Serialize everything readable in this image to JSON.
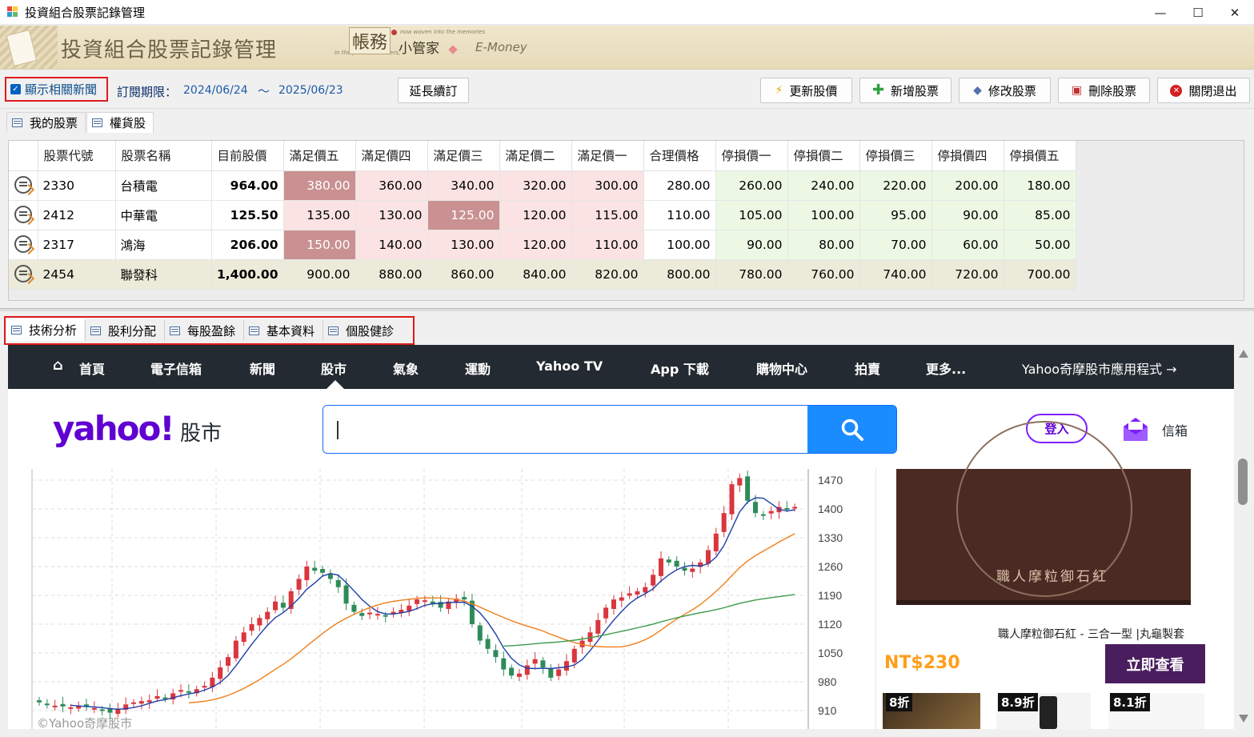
{
  "window": {
    "title": "投資組合股票記錄管理",
    "controls": {
      "minimize": "—",
      "maximize": "☐",
      "close": "✕"
    }
  },
  "banner": {
    "title": "投資組合股票記錄管理",
    "brand_main": "帳務",
    "brand_sub": "小管家",
    "brand_en": "E-Money",
    "tagline1": "now woven into the memories",
    "tagline2": "In the past of numbers,"
  },
  "toolbar": {
    "show_news_label": "顯示相關新聞",
    "show_news_checked": true,
    "subscription_label": "訂閱期限：",
    "subscription_start": "2024/06/24",
    "subscription_sep": "～",
    "subscription_end": "2025/06/23",
    "extend_label": "延長續訂",
    "buttons": {
      "refresh": "更新股價",
      "add": "新增股票",
      "edit": "修改股票",
      "delete": "刪除股票",
      "exit": "關閉退出"
    }
  },
  "top_tabs": [
    {
      "label": "我的股票"
    },
    {
      "label": "權貨股"
    }
  ],
  "grid": {
    "columns": [
      "股票代號",
      "股票名稱",
      "目前股價",
      "滿足價五",
      "滿足價四",
      "滿足價三",
      "滿足價二",
      "滿足價一",
      "合理價格",
      "停損價一",
      "停損價二",
      "停損價三",
      "停損價四",
      "停損價五"
    ],
    "rows": [
      {
        "code": "2330",
        "name": "台積電",
        "price": "964.00",
        "v": [
          "380.00",
          "360.00",
          "340.00",
          "320.00",
          "300.00",
          "280.00",
          "260.00",
          "240.00",
          "220.00",
          "200.00",
          "180.00"
        ]
      },
      {
        "code": "2412",
        "name": "中華電",
        "price": "125.50",
        "v": [
          "135.00",
          "130.00",
          "125.00",
          "120.00",
          "115.00",
          "110.00",
          "105.00",
          "100.00",
          "95.00",
          "90.00",
          "85.00"
        ]
      },
      {
        "code": "2317",
        "name": "鴻海",
        "price": "206.00",
        "v": [
          "150.00",
          "140.00",
          "130.00",
          "120.00",
          "110.00",
          "100.00",
          "90.00",
          "80.00",
          "70.00",
          "60.00",
          "50.00"
        ]
      },
      {
        "code": "2454",
        "name": "聯發科",
        "price": "1,400.00",
        "v": [
          "900.00",
          "880.00",
          "860.00",
          "840.00",
          "820.00",
          "800.00",
          "780.00",
          "760.00",
          "740.00",
          "720.00",
          "700.00"
        ]
      }
    ],
    "highlight_color": "#c99191",
    "target_color": "#fbe3e3",
    "stop_color": "#ecf8e4",
    "selected_row_color": "#ecebd9"
  },
  "bottom_tabs": [
    {
      "label": "技術分析"
    },
    {
      "label": "股利分配"
    },
    {
      "label": "每股盈餘"
    },
    {
      "label": "基本資料"
    },
    {
      "label": "個股健診"
    }
  ],
  "yahoo": {
    "nav": [
      "首頁",
      "電子信箱",
      "新聞",
      "股市",
      "氣象",
      "運動",
      "Yahoo TV",
      "App 下載",
      "購物中心",
      "拍賣",
      "更多...",
      "Yahoo奇摩股市應用程式 →"
    ],
    "logo": "yahoo!",
    "logo_sub": "股市",
    "search_value": "",
    "login_label": "登入",
    "mail_label": "信箱",
    "brand_color": "#6001d2",
    "nav_bg": "#232a31",
    "search_button_color": "#1a8cff"
  },
  "chart_data": {
    "type": "line",
    "title": "",
    "watermark": "©Yahoo奇摩股市",
    "y_ticks": [
      "1470",
      "1400",
      "1330",
      "1260",
      "1190",
      "1120",
      "1050",
      "980",
      "910"
    ],
    "ylim": [
      880,
      1500
    ],
    "candles_close": [
      930,
      925,
      922,
      920,
      918,
      921,
      919,
      916,
      912,
      905,
      915,
      925,
      930,
      933,
      935,
      945,
      940,
      952,
      960,
      955,
      962,
      970,
      990,
      1015,
      1040,
      1080,
      1100,
      1120,
      1135,
      1150,
      1175,
      1160,
      1200,
      1230,
      1260,
      1250,
      1245,
      1230,
      1210,
      1170,
      1150,
      1140,
      1148,
      1145,
      1140,
      1150,
      1155,
      1165,
      1180,
      1178,
      1170,
      1160,
      1175,
      1182,
      1180,
      1120,
      1080,
      1060,
      1040,
      1010,
      995,
      1000,
      1020,
      1035,
      1015,
      990,
      1010,
      1030,
      1060,
      1080,
      1100,
      1130,
      1160,
      1180,
      1185,
      1195,
      1200,
      1210,
      1240,
      1280,
      1270,
      1260,
      1250,
      1255,
      1270,
      1300,
      1340,
      1390,
      1460,
      1475,
      1420,
      1390,
      1385,
      1395,
      1405,
      1400,
      1405
    ],
    "series": [
      {
        "values": [
          0,
          1
        ]
      },
      {
        "values": [
          0,
          1
        ]
      },
      {
        "values": [
          0,
          1
        ]
      }
    ],
    "colors": {
      "up": "#d9363e",
      "down": "#2e8b57",
      "ma5": "#1f3fa8",
      "ma20": "#f07f19",
      "ma60": "#3c9b4a"
    }
  },
  "ad": {
    "box_text": "職人摩粒御石紅",
    "title": "職人摩粒御石紅 - 三合一型 |丸龜製套",
    "price": "NT$230",
    "cta": "立即查看",
    "badges": [
      "8折",
      "8.9折",
      "8.1折"
    ]
  }
}
